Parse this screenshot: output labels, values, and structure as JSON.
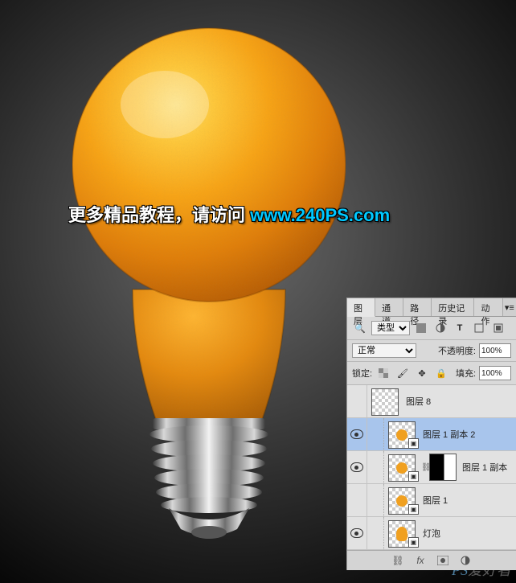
{
  "overlay": {
    "text_prefix": "更多精品教程，请访问 ",
    "url": "www.240PS.com"
  },
  "watermark": {
    "ps": "PS",
    "rest": "爱好者"
  },
  "panel": {
    "tabs": [
      "图层",
      "通道",
      "路径",
      "历史记录",
      "动作"
    ],
    "active_tab": 0,
    "filter": {
      "label": "类型",
      "icons": [
        "image",
        "fx",
        "text",
        "shape",
        "smart"
      ]
    },
    "mode": {
      "label": "正常",
      "opacity_label": "不透明度:",
      "opacity_value": "100%"
    },
    "lock": {
      "label": "锁定:",
      "fill_label": "填充:",
      "fill_value": "100%"
    },
    "layers": [
      {
        "visible": false,
        "name": "图层 8",
        "indent": 0,
        "thumb": "checker",
        "smart": false,
        "mask": false
      },
      {
        "visible": true,
        "name": "图层 1 副本 2",
        "indent": 1,
        "thumb": "orange",
        "smart": true,
        "mask": false,
        "selected": true
      },
      {
        "visible": true,
        "name": "图层 1 副本",
        "indent": 1,
        "thumb": "orange",
        "smart": true,
        "mask": true
      },
      {
        "visible": false,
        "name": "图层 1",
        "indent": 1,
        "thumb": "orange",
        "smart": true,
        "mask": false
      },
      {
        "visible": true,
        "name": "灯泡",
        "indent": 1,
        "thumb": "bulb",
        "smart": true,
        "mask": false
      }
    ]
  }
}
